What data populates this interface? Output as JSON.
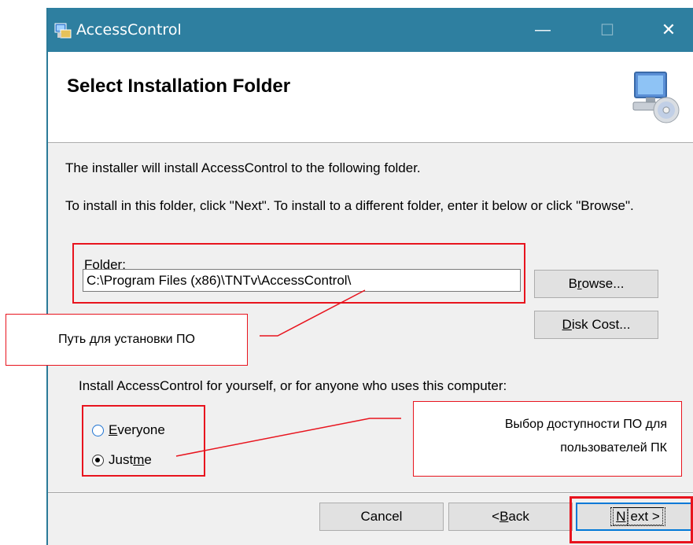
{
  "window": {
    "title": "AccessControl",
    "icon": "installer-app-icon",
    "minimize_glyph": "—",
    "maximize_glyph": "☐",
    "close_glyph": "✕"
  },
  "header": {
    "title": "Select Installation Folder",
    "icon": "computer-cd-icon"
  },
  "body": {
    "intro": "The installer will install AccessControl to the following folder.",
    "instructions": "To install in this folder, click \"Next\". To install to a different folder, enter it below or click \"Browse\".",
    "folder_label_first": "F",
    "folder_label_rest": "older:",
    "folder_value": "C:\\Program Files (x86)\\TNTv\\AccessControl\\",
    "browse": {
      "pre": "B",
      "accel": "r",
      "post": "owse..."
    },
    "disk_cost": {
      "accel": "D",
      "post": "isk Cost..."
    },
    "install_for": "Install AccessControl for yourself, or for anyone who uses this computer:",
    "radio_everyone": {
      "accel": "E",
      "post": "veryone",
      "checked": false
    },
    "radio_justme": {
      "pre": "Just ",
      "accel": "m",
      "post": "e",
      "checked": true
    }
  },
  "footer": {
    "cancel": "Cancel",
    "back": {
      "pre": "< ",
      "accel": "B",
      "post": "ack"
    },
    "next": {
      "accel": "N",
      "post": "ext >"
    }
  },
  "annotations": {
    "path_callout": "Путь для установки ПО",
    "access_callout_line1": "Выбор доступности ПО для",
    "access_callout_line2": "пользователей ПК",
    "color": "#e8141e"
  }
}
